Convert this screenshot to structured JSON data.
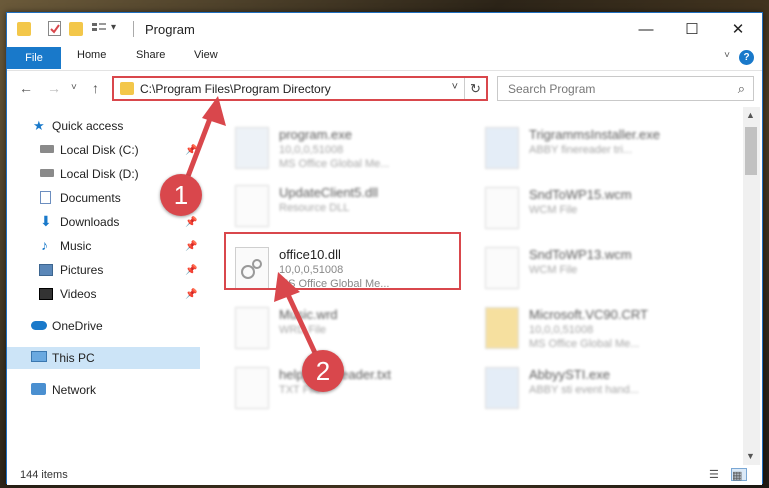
{
  "window": {
    "title": "Program",
    "minimize": "—",
    "maximize": "☐",
    "close": "✕"
  },
  "ribbon": {
    "file": "File",
    "home": "Home",
    "share": "Share",
    "view": "View",
    "help": "?",
    "expand": "˅"
  },
  "address": {
    "path": "C:\\Program Files\\Program Directory",
    "dropdown": "˅",
    "refresh": "↻"
  },
  "search": {
    "placeholder": "Search Program",
    "icon": "⌕"
  },
  "nav": {
    "back": "←",
    "forward": "→",
    "recent": "˅",
    "up": "↑",
    "items": [
      {
        "label": "Quick access",
        "icon": "star-icon"
      },
      {
        "label": "Local Disk (C:)",
        "icon": "drive-icon"
      },
      {
        "label": "Local Disk (D:)",
        "icon": "drive-icon"
      },
      {
        "label": "Documents",
        "icon": "documents-icon"
      },
      {
        "label": "Downloads",
        "icon": "download-icon"
      },
      {
        "label": "Music",
        "icon": "music-icon"
      },
      {
        "label": "Pictures",
        "icon": "pictures-icon"
      },
      {
        "label": "Videos",
        "icon": "video-icon"
      },
      {
        "label": "OneDrive",
        "icon": "cloud-icon"
      },
      {
        "label": "This PC",
        "icon": "pc-icon"
      },
      {
        "label": "Network",
        "icon": "network-icon"
      }
    ],
    "pin": "📌"
  },
  "files": [
    {
      "name": "program.exe",
      "line1": "10,0,0,51008",
      "line2": "MS Office Global Me..."
    },
    {
      "name": "UpdateClient5.dll",
      "line1": "Resource DLL",
      "line2": ""
    },
    {
      "name": "office10.dll",
      "line1": "10,0,0,51008",
      "line2": "MS Office Global Me..."
    },
    {
      "name": "Music.wrd",
      "line1": "WRD File",
      "line2": ""
    },
    {
      "name": "help_fineReader.txt",
      "line1": "TXT File",
      "line2": ""
    },
    {
      "name": "TrigrammsInstaller.exe",
      "line1": "ABBY finereader tri...",
      "line2": ""
    },
    {
      "name": "SndToWP15.wcm",
      "line1": "WCM File",
      "line2": ""
    },
    {
      "name": "SndToWP13.wcm",
      "line1": "WCM File",
      "line2": ""
    },
    {
      "name": "Microsoft.VC90.CRT",
      "line1": "10,0,0,51008",
      "line2": "MS Office Global Me..."
    },
    {
      "name": "AbbyySTI.exe",
      "line1": "ABBY sti event hand...",
      "line2": ""
    }
  ],
  "status": {
    "items": "144 items"
  },
  "annotations": {
    "one": "1",
    "two": "2"
  },
  "colors": {
    "accent": "#1979ca",
    "highlight": "#d9474c",
    "selection": "#cce4f7"
  }
}
